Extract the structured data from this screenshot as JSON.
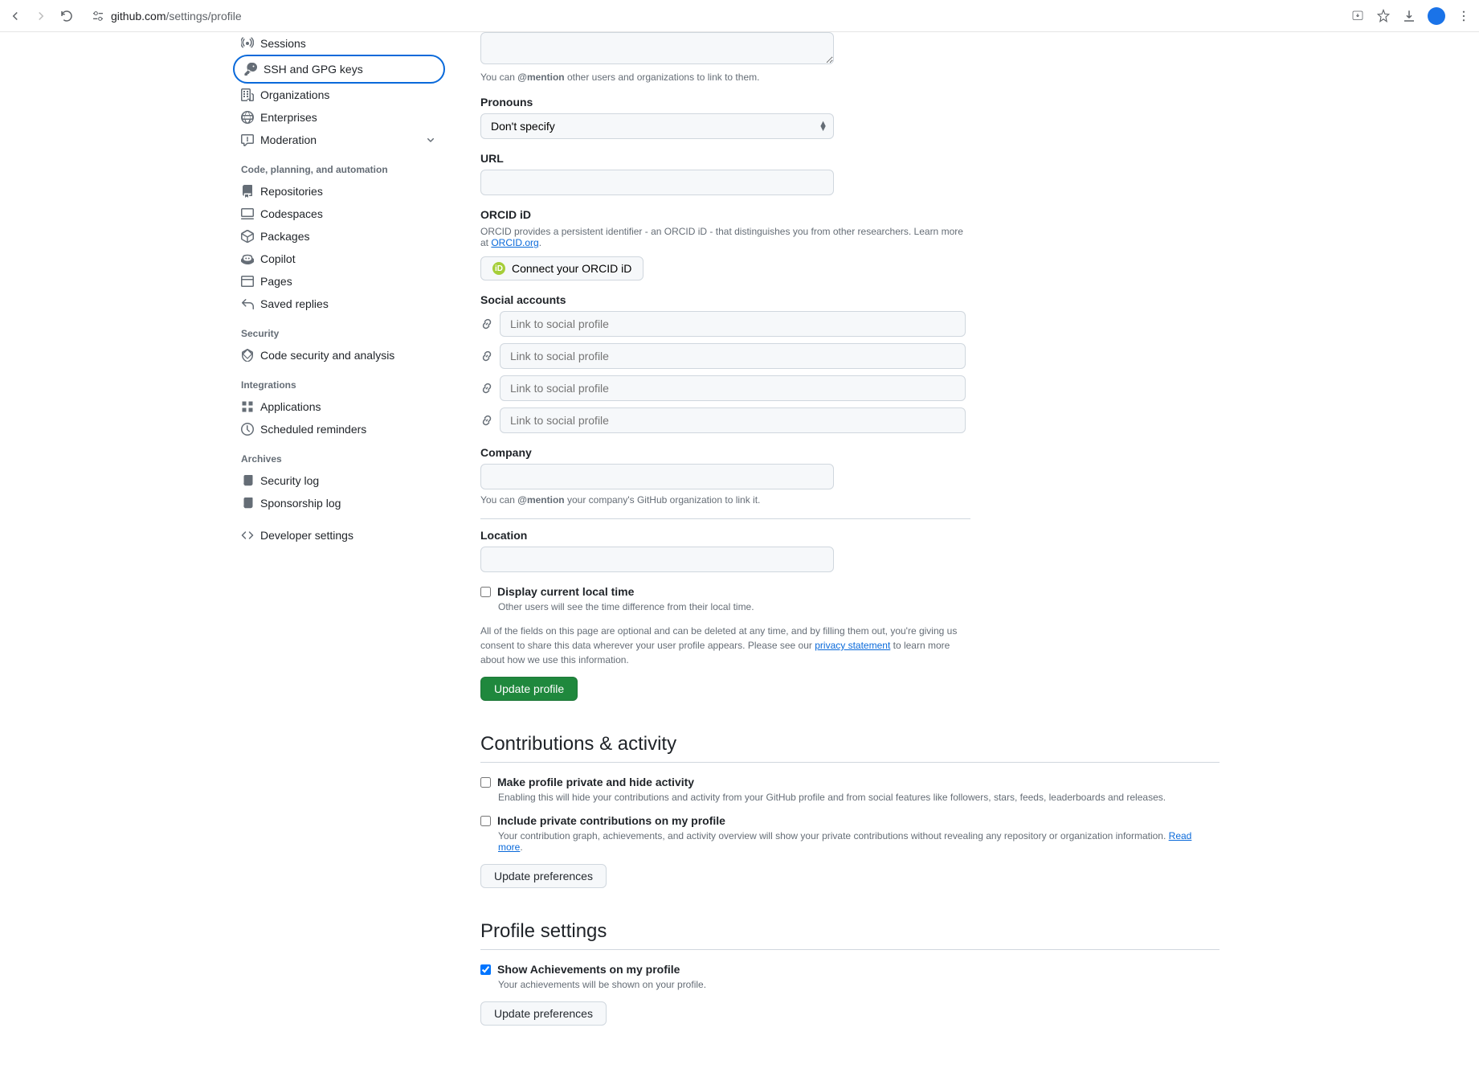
{
  "browser": {
    "url_domain": "github.com",
    "url_path": "/settings/profile"
  },
  "sidebar": {
    "items_top": [
      {
        "label": "Sessions",
        "icon": "broadcast"
      },
      {
        "label": "SSH and GPG keys",
        "icon": "key",
        "selected": true
      },
      {
        "label": "Organizations",
        "icon": "organization"
      },
      {
        "label": "Enterprises",
        "icon": "globe"
      },
      {
        "label": "Moderation",
        "icon": "report",
        "chevron": true
      }
    ],
    "heading_code": "Code, planning, and automation",
    "items_code": [
      {
        "label": "Repositories",
        "icon": "repo"
      },
      {
        "label": "Codespaces",
        "icon": "codespaces"
      },
      {
        "label": "Packages",
        "icon": "package"
      },
      {
        "label": "Copilot",
        "icon": "copilot"
      },
      {
        "label": "Pages",
        "icon": "browser"
      },
      {
        "label": "Saved replies",
        "icon": "reply"
      }
    ],
    "heading_security": "Security",
    "items_security": [
      {
        "label": "Code security and analysis",
        "icon": "shield"
      }
    ],
    "heading_integrations": "Integrations",
    "items_integrations": [
      {
        "label": "Applications",
        "icon": "apps"
      },
      {
        "label": "Scheduled reminders",
        "icon": "clock"
      }
    ],
    "heading_archives": "Archives",
    "items_archives": [
      {
        "label": "Security log",
        "icon": "log"
      },
      {
        "label": "Sponsorship log",
        "icon": "log"
      }
    ],
    "developer": {
      "label": "Developer settings",
      "icon": "code"
    }
  },
  "form": {
    "bio_note_pre": "You can ",
    "bio_note_bold": "@mention",
    "bio_note_post": " other users and organizations to link to them.",
    "pronouns_label": "Pronouns",
    "pronouns_value": "Don't specify",
    "url_label": "URL",
    "orcid_label": "ORCID iD",
    "orcid_desc_pre": "ORCID provides a persistent identifier - an ORCID iD - that distinguishes you from other researchers. Learn more at ",
    "orcid_link": "ORCID.org",
    "orcid_btn": "Connect your ORCID iD",
    "social_label": "Social accounts",
    "social_placeholder": "Link to social profile",
    "company_label": "Company",
    "company_note_pre": "You can ",
    "company_note_bold": "@mention",
    "company_note_post": " your company's GitHub organization to link it.",
    "location_label": "Location",
    "localtime_label": "Display current local time",
    "localtime_note": "Other users will see the time difference from their local time.",
    "disclaimer_pre": "All of the fields on this page are optional and can be deleted at any time, and by filling them out, you're giving us consent to share this data wherever your user profile appears. Please see our ",
    "disclaimer_link": "privacy statement",
    "disclaimer_post": " to learn more about how we use this information.",
    "update_profile_btn": "Update profile"
  },
  "contributions": {
    "heading": "Contributions & activity",
    "private_label": "Make profile private and hide activity",
    "private_note": "Enabling this will hide your contributions and activity from your GitHub profile and from social features like followers, stars, feeds, leaderboards and releases.",
    "include_label": "Include private contributions on my profile",
    "include_note_pre": "Your contribution graph, achievements, and activity overview will show your private contributions without revealing any repository or organization information. ",
    "include_link": "Read more",
    "update_btn": "Update preferences"
  },
  "profile_settings": {
    "heading": "Profile settings",
    "achievements_label": "Show Achievements on my profile",
    "achievements_note": "Your achievements will be shown on your profile.",
    "update_btn": "Update preferences"
  }
}
